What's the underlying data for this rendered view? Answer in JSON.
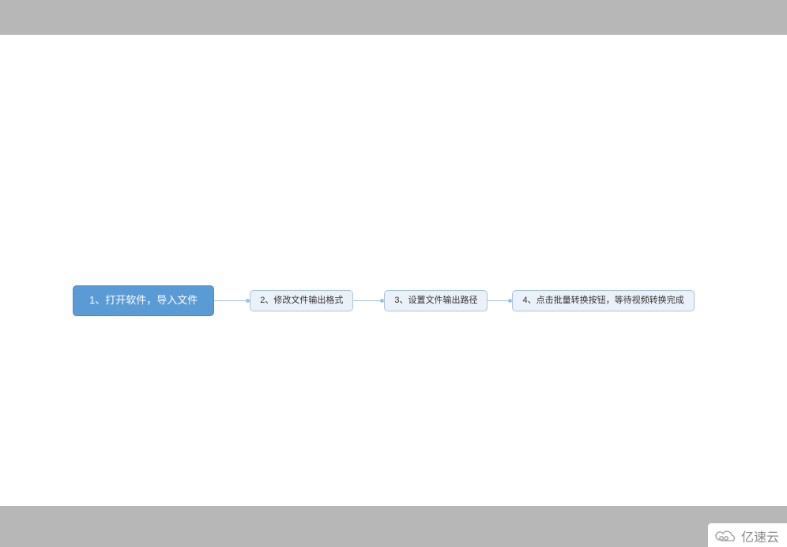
{
  "flow": {
    "nodes": [
      {
        "label": "1、打开软件，导入文件",
        "type": "primary"
      },
      {
        "label": "2、修改文件输出格式",
        "type": "secondary"
      },
      {
        "label": "3、设置文件输出路径",
        "type": "secondary"
      },
      {
        "label": "4、点击批量转换按钮，等待视频转换完成",
        "type": "secondary"
      }
    ]
  },
  "watermark": {
    "text": "亿速云"
  }
}
